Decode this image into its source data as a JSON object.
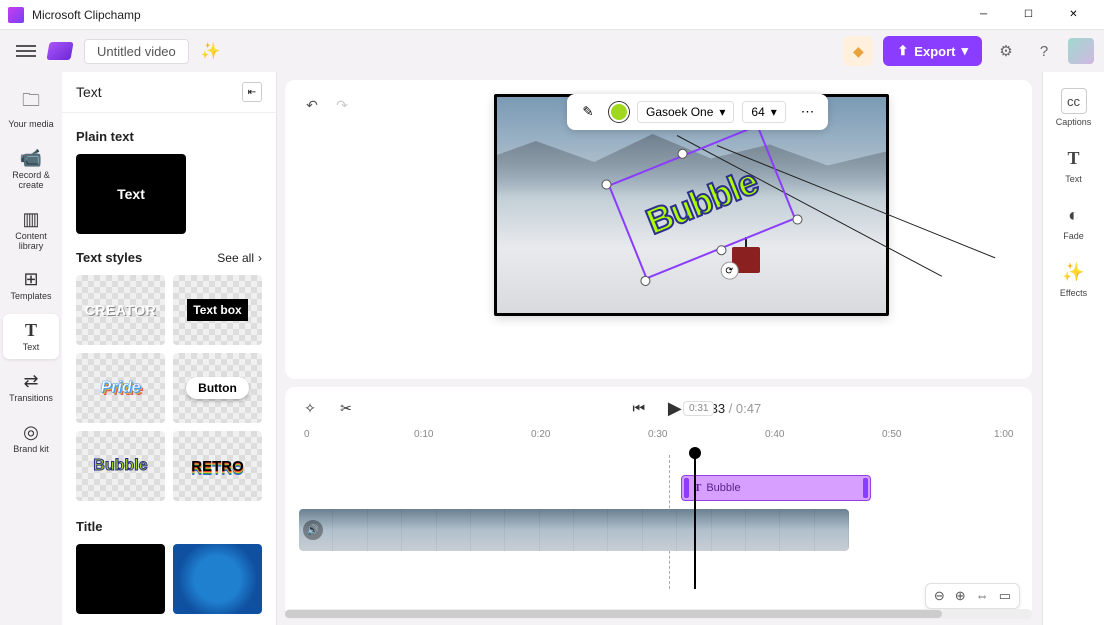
{
  "app": {
    "title": "Microsoft Clipchamp"
  },
  "toolbar": {
    "video_name": "Untitled video",
    "export_label": "Export"
  },
  "leftnav": {
    "items": [
      {
        "icon": "🗀",
        "label": "Your media"
      },
      {
        "icon": "⏺",
        "label": "Record & create"
      },
      {
        "icon": "▥",
        "label": "Content library"
      },
      {
        "icon": "⊞",
        "label": "Templates"
      },
      {
        "icon": "T",
        "label": "Text"
      },
      {
        "icon": "⇄",
        "label": "Transitions"
      },
      {
        "icon": "◎",
        "label": "Brand kit"
      }
    ],
    "active_index": 4
  },
  "sidepanel": {
    "title": "Text",
    "plain_section": "Plain text",
    "plain_thumb": "Text",
    "styles_section": "Text styles",
    "see_all": "See all",
    "tiles": [
      "CREATOR",
      "Text box",
      "Pride",
      "Button",
      "Bubble",
      "RETRO"
    ],
    "title_section": "Title"
  },
  "editor": {
    "font_name": "Gasoek One",
    "font_size": "64",
    "canvas_text": "Bubble"
  },
  "timeline": {
    "current": "0:33",
    "duration": "0:47",
    "playhead_label": "0:31",
    "marks": [
      "0",
      "0:10",
      "0:20",
      "0:30",
      "0:40",
      "0:50",
      "1:00"
    ],
    "text_clip": "Bubble"
  },
  "rightnav": {
    "items": [
      {
        "icon": "cc",
        "label": "Captions"
      },
      {
        "icon": "T",
        "label": "Text"
      },
      {
        "icon": "◐",
        "label": "Fade"
      },
      {
        "icon": "✨",
        "label": "Effects"
      }
    ]
  }
}
